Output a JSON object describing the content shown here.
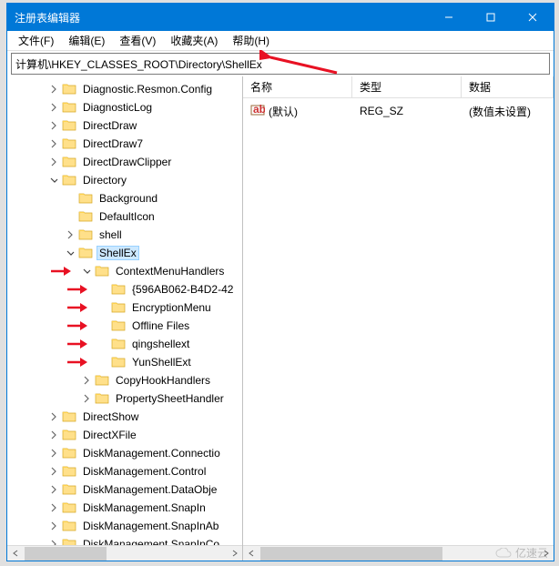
{
  "window": {
    "title": "注册表编辑器",
    "minimize": "—",
    "maximize": "□",
    "close": "✕"
  },
  "menu": {
    "file": "文件(F)",
    "edit": "编辑(E)",
    "view": "查看(V)",
    "favorites": "收藏夹(A)",
    "help": "帮助(H)"
  },
  "address": {
    "path": "计算机\\HKEY_CLASSES_ROOT\\Directory\\ShellEx"
  },
  "tree": [
    {
      "indent": 2,
      "exp": ">",
      "label": "Diagnostic.Resmon.Config"
    },
    {
      "indent": 2,
      "exp": ">",
      "label": "DiagnosticLog"
    },
    {
      "indent": 2,
      "exp": ">",
      "label": "DirectDraw"
    },
    {
      "indent": 2,
      "exp": ">",
      "label": "DirectDraw7"
    },
    {
      "indent": 2,
      "exp": ">",
      "label": "DirectDrawClipper"
    },
    {
      "indent": 2,
      "exp": "v",
      "label": "Directory"
    },
    {
      "indent": 3,
      "exp": "",
      "label": "Background"
    },
    {
      "indent": 3,
      "exp": "",
      "label": "DefaultIcon"
    },
    {
      "indent": 3,
      "exp": ">",
      "label": "shell"
    },
    {
      "indent": 3,
      "exp": "v",
      "label": "ShellEx",
      "selected": true
    },
    {
      "indent": 4,
      "exp": "v",
      "label": "ContextMenuHandlers",
      "red": true
    },
    {
      "indent": 5,
      "exp": "",
      "label": "{596AB062-B4D2-42",
      "red": true
    },
    {
      "indent": 5,
      "exp": "",
      "label": "EncryptionMenu",
      "red": true
    },
    {
      "indent": 5,
      "exp": "",
      "label": "Offline Files",
      "red": true
    },
    {
      "indent": 5,
      "exp": "",
      "label": "qingshellext",
      "red": true
    },
    {
      "indent": 5,
      "exp": "",
      "label": "YunShellExt",
      "red": true
    },
    {
      "indent": 4,
      "exp": ">",
      "label": "CopyHookHandlers"
    },
    {
      "indent": 4,
      "exp": ">",
      "label": "PropertySheetHandler"
    },
    {
      "indent": 2,
      "exp": ">",
      "label": "DirectShow"
    },
    {
      "indent": 2,
      "exp": ">",
      "label": "DirectXFile"
    },
    {
      "indent": 2,
      "exp": ">",
      "label": "DiskManagement.Connectio"
    },
    {
      "indent": 2,
      "exp": ">",
      "label": "DiskManagement.Control"
    },
    {
      "indent": 2,
      "exp": ">",
      "label": "DiskManagement.DataObje"
    },
    {
      "indent": 2,
      "exp": ">",
      "label": "DiskManagement.SnapIn"
    },
    {
      "indent": 2,
      "exp": ">",
      "label": "DiskManagement.SnapInAb"
    },
    {
      "indent": 2,
      "exp": ">",
      "label": "DiskManagement.SnapInCo"
    }
  ],
  "list": {
    "cols": {
      "name": "名称",
      "type": "类型",
      "data": "数据"
    },
    "col_widths": {
      "name": 120,
      "type": 120,
      "data": 120
    },
    "rows": [
      {
        "name": "(默认)",
        "type": "REG_SZ",
        "data": "(数值未设置)"
      }
    ]
  },
  "annotations": {
    "address_arrow": true
  },
  "watermark": "亿速云"
}
